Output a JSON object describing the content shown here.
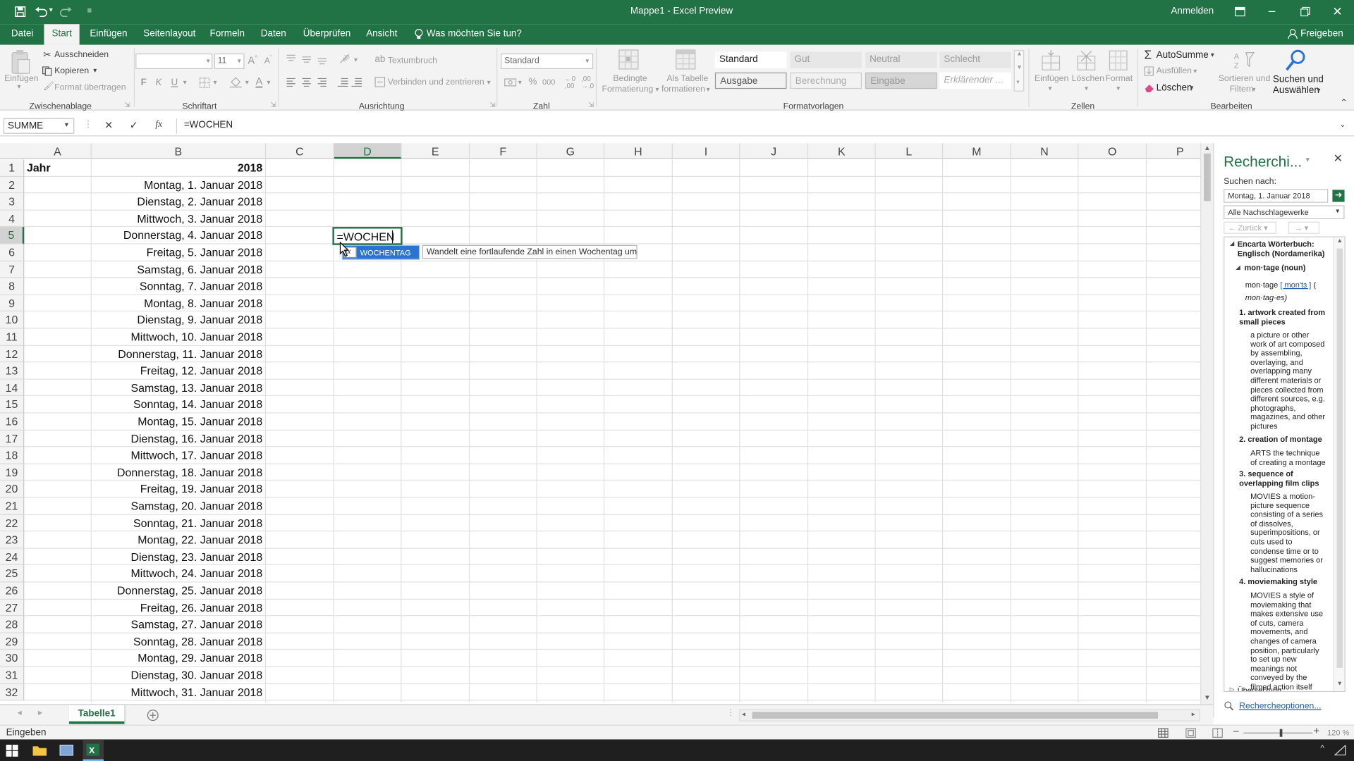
{
  "app": {
    "window_title": "Mappe1 - Excel Preview",
    "sign_in": "Anmelden"
  },
  "ribbon": {
    "tabs": [
      "Datei",
      "Start",
      "Einfügen",
      "Seitenlayout",
      "Formeln",
      "Daten",
      "Überprüfen",
      "Ansicht"
    ],
    "active_tab": "Start",
    "tell_me": "Was möchten Sie tun?",
    "share": "Freigeben",
    "clipboard": {
      "paste": "Einfügen",
      "cut": "Ausschneiden",
      "copy": "Kopieren",
      "format_painter": "Format übertragen",
      "group": "Zwischenablage"
    },
    "font": {
      "size": "11",
      "bold": "F",
      "italic": "K",
      "underline": "U",
      "group": "Schriftart"
    },
    "alignment": {
      "wrap": "Textumbruch",
      "merge": "Verbinden und zentrieren",
      "group": "Ausrichtung"
    },
    "number": {
      "format": "Standard",
      "group": "Zahl"
    },
    "styles": {
      "conditional": [
        "Bedingte",
        "Formatierung"
      ],
      "as_table": [
        "Als Tabelle",
        "formatieren"
      ],
      "cells": [
        "Standard",
        "Gut",
        "Neutral",
        "Schlecht",
        "Ausgabe",
        "Berechnung",
        "Eingabe",
        "Erklärender ..."
      ],
      "group": "Formatvorlagen"
    },
    "cells": {
      "insert": "Einfügen",
      "delete": "Löschen",
      "format": "Format",
      "group": "Zellen"
    },
    "editing": {
      "autosum": "AutoSumme",
      "fill": "Ausfüllen",
      "clear": "Löschen",
      "sort": [
        "Sortieren und",
        "Filtern"
      ],
      "find": [
        "Suchen und",
        "Auswählen"
      ],
      "group": "Bearbeiten"
    }
  },
  "formula_bar": {
    "name_box": "SUMME",
    "fx": "fx",
    "content": "=WOCHEN"
  },
  "grid": {
    "columns": [
      "A",
      "B",
      "C",
      "D",
      "E",
      "F",
      "G",
      "H",
      "I",
      "J",
      "K",
      "L",
      "M",
      "N",
      "O",
      "P"
    ],
    "rows": [
      "1",
      "2",
      "3",
      "4",
      "5",
      "6",
      "7",
      "8",
      "9",
      "10",
      "11",
      "12",
      "13",
      "14",
      "15",
      "16",
      "17",
      "18",
      "19",
      "20",
      "21",
      "22",
      "23",
      "24",
      "25",
      "26",
      "27",
      "28",
      "29",
      "30",
      "31",
      "32"
    ],
    "a1": "Jahr",
    "b_values": [
      "2018",
      "Montag, 1. Januar 2018",
      "Dienstag, 2. Januar 2018",
      "Mittwoch, 3. Januar 2018",
      "Donnerstag, 4. Januar 2018",
      "Freitag, 5. Januar 2018",
      "Samstag, 6. Januar 2018",
      "Sonntag, 7. Januar 2018",
      "Montag, 8. Januar 2018",
      "Dienstag, 9. Januar 2018",
      "Mittwoch, 10. Januar 2018",
      "Donnerstag, 11. Januar 2018",
      "Freitag, 12. Januar 2018",
      "Samstag, 13. Januar 2018",
      "Sonntag, 14. Januar 2018",
      "Montag, 15. Januar 2018",
      "Dienstag, 16. Januar 2018",
      "Mittwoch, 17. Januar 2018",
      "Donnerstag, 18. Januar 2018",
      "Freitag, 19. Januar 2018",
      "Samstag, 20. Januar 2018",
      "Sonntag, 21. Januar 2018",
      "Montag, 22. Januar 2018",
      "Dienstag, 23. Januar 2018",
      "Mittwoch, 24. Januar 2018",
      "Donnerstag, 25. Januar 2018",
      "Freitag, 26. Januar 2018",
      "Samstag, 27. Januar 2018",
      "Sonntag, 28. Januar 2018",
      "Montag, 29. Januar 2018",
      "Dienstag, 30. Januar 2018",
      "Mittwoch, 31. Januar 2018"
    ],
    "active_cell": "D5",
    "editing_value": "=WOCHEN",
    "autocomplete": {
      "item": "WOCHENTAG",
      "tooltip": "Wandelt eine fortlaufende Zahl in einen Wochentag um",
      "icon_label": "fx"
    }
  },
  "research": {
    "title": "Recherchi...",
    "search_label": "Suchen nach:",
    "search_value": "Montag, 1. Januar 2018",
    "source": "Alle Nachschlagewerke",
    "back": "Zurück",
    "dictionary": "Encarta Wörterbuch: Englisch (Nordamerika)",
    "headword": "mon·tage (noun)",
    "pron_a": "mon·tage",
    "pron_b": "[ mon'tɜ ]",
    "pron_c": "(",
    "plural": "mon·tag·es)",
    "senses": [
      {
        "head": "1. artwork created from small pieces",
        "body": "a picture or other work of art composed by assembling, overlaying, and overlapping many different materials or pieces collected from different sources, e.g. photographs, magazines, and other pictures"
      },
      {
        "head": "2. creation of montage",
        "body": "ARTS the technique of creating a montage"
      },
      {
        "head": "3. sequence of overlapping film clips",
        "body": "MOVIES a motion-picture sequence consisting of a series of dissolves, superimpositions, or cuts used to condense time or to suggest memories or hallucinations"
      },
      {
        "head": "4. moviemaking style",
        "body": "MOVIES a style of moviemaking that makes extensive use of cuts, camera movements, and changes of camera position, particularly to set up new meanings not conveyed by the filmed action itself"
      }
    ],
    "translation": "Übersetzung",
    "options": "Rechercheoptionen..."
  },
  "sheets": {
    "tabs": [
      "Tabelle1"
    ]
  },
  "status": {
    "mode": "Eingeben",
    "zoom": "120 %"
  },
  "colors": {
    "excel_green": "#217346",
    "select_blue": "#2b73d2"
  }
}
